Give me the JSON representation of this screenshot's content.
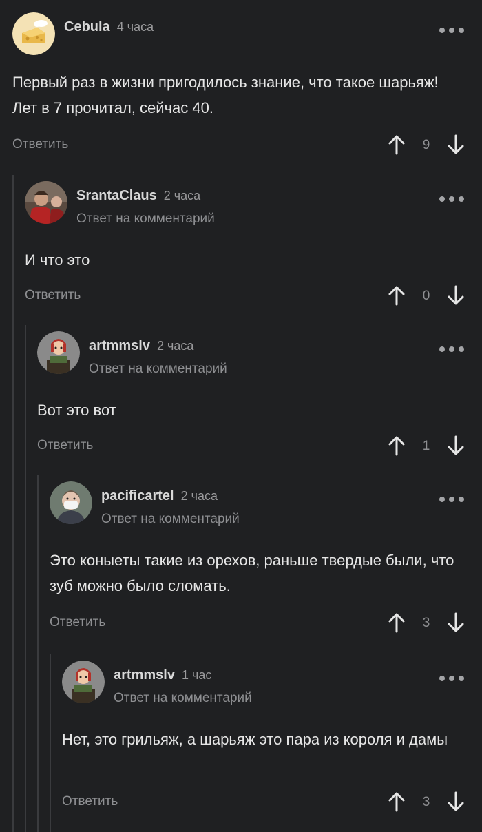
{
  "labels": {
    "reply": "Ответить",
    "reply_to": "Ответ на комментарий"
  },
  "comments": [
    {
      "username": "Cebula",
      "time": "4 часа",
      "text": "Первый раз в жизни пригодилось знание, что такое шарьяж! Лет в 7 прочитал, сейчас 40.",
      "votes": "9",
      "avatar": "cheese-avatar"
    },
    {
      "username": "SrantaClaus",
      "time": "2 часа",
      "text": "И что это",
      "votes": "0",
      "avatar": "santa-photo-avatar"
    },
    {
      "username": "artmmslv",
      "time": "2 часа",
      "text": "Вот это вот",
      "votes": "1",
      "avatar": "cartoon-redhead-avatar"
    },
    {
      "username": "pacificartel",
      "time": "2 часа",
      "text": "Это коныеты такие из орехов, раньше твердые были, что зуб можно было сломать.",
      "votes": "3",
      "avatar": "masked-person-avatar"
    },
    {
      "username": "artmmslv",
      "time": "1 час",
      "text": "Нет, это грильяж, а шарьяж это пара из короля и дамы",
      "votes": "3",
      "avatar": "cartoon-redhead-avatar"
    }
  ],
  "colors": {
    "background": "#1f2022",
    "text": "#e6e6e6",
    "muted": "#8e8f92",
    "thread_line": "#3a3b3e"
  }
}
